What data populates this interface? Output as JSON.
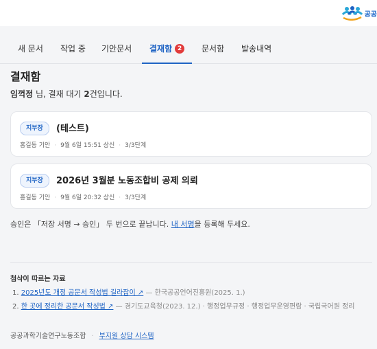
{
  "header": {
    "logo_text": "공공"
  },
  "tabs": [
    {
      "label": "새 문서"
    },
    {
      "label": "작업 중"
    },
    {
      "label": "기안문서"
    },
    {
      "label": "결재함",
      "badge": "2"
    },
    {
      "label": "문서함"
    },
    {
      "label": "발송내역"
    }
  ],
  "page": {
    "title": "결재함",
    "summary_name": "임꺽정",
    "summary_mid": " 님, 결재 대기 ",
    "summary_count": "2",
    "summary_end": "건입니다."
  },
  "cards": [
    {
      "chip": "지부장",
      "title": "(테스트)",
      "author": "홍길동 기안",
      "date": "9월 6일 15:51 상신",
      "stage": "3/3단계"
    },
    {
      "chip": "지부장",
      "title": "2026년 3월분 노동조합비 공제 의뢰",
      "author": "홍길동 기안",
      "date": "9월 6일 20:32 상신",
      "stage": "3/3단계"
    }
  ],
  "note": {
    "before": "승인은 「저장 서명 → 승인」 두 번으로 끝납니다. ",
    "link": "내 서명",
    "after": "을 등록해 두세요."
  },
  "references": {
    "title": "첨삭이 따르는 자료",
    "items": [
      {
        "num": "1.",
        "link": "2025년도 개정 공문서 작성법 길라잡이 ↗",
        "rest": " — 한국공공언어진흥원(2025. 1.)"
      },
      {
        "num": "2.",
        "link": "한 곳에 정리한 공문서 작성법 ↗",
        "rest": " — 경기도교육청(2023. 12.) · 행정업무규정 · 행정업무운영편람 · 국립국어원 정리"
      }
    ]
  },
  "footer": {
    "org": "공공과학기술연구노동조합",
    "sep": "·",
    "link": "부지원 상담 시스템"
  },
  "colors": {
    "accent": "#1e63c4",
    "badge": "#e23b3b",
    "background": "#f4f5f7"
  }
}
